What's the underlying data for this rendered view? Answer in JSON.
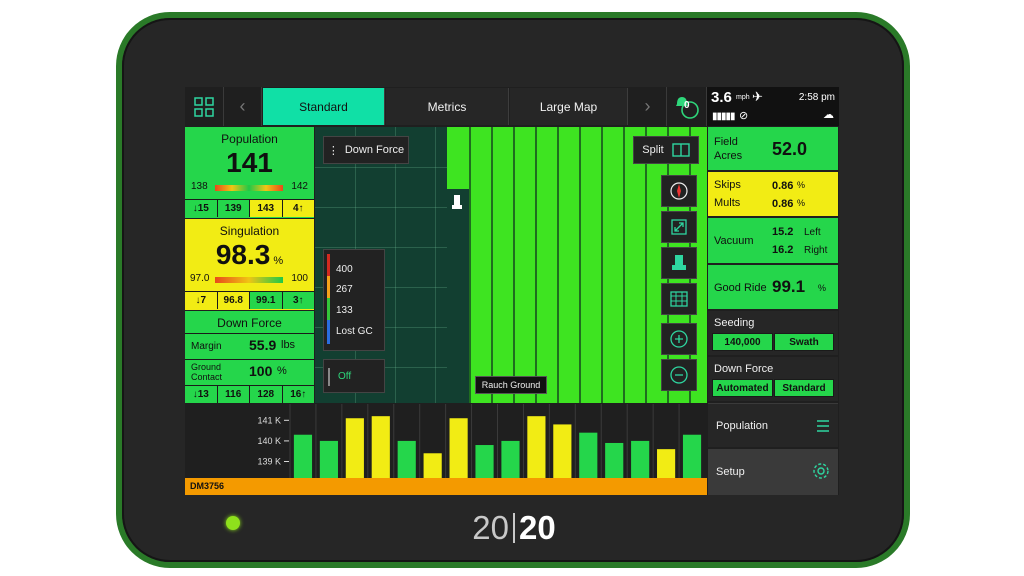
{
  "nav": {
    "tabs": [
      "Standard",
      "Metrics",
      "Large Map"
    ],
    "alert_count": "0"
  },
  "status": {
    "speed": "3.6",
    "speed_unit": "mph",
    "time": "2:58 pm"
  },
  "population": {
    "title": "Population",
    "value": "141",
    "min": "138",
    "max": "142",
    "cells": [
      "↓15",
      "139",
      "143",
      "4↑"
    ]
  },
  "singulation": {
    "title": "Singulation",
    "value": "98.3",
    "unit": "%",
    "min": "97.0",
    "max": "100",
    "cells": [
      "↓7",
      "96.8",
      "99.1",
      "3↑"
    ]
  },
  "down_force": {
    "title": "Down Force",
    "margin_label": "Margin",
    "margin_value": "55.9",
    "margin_unit": "lbs",
    "gc_label_1": "Ground",
    "gc_label_2": "Contact",
    "gc_value": "100",
    "gc_unit": "%",
    "cells": [
      "↓13",
      "116",
      "128",
      "16↑"
    ]
  },
  "map": {
    "layer_button": "Down Force",
    "split_button": "Split",
    "legend": [
      "400",
      "267",
      "133",
      "Lost GC"
    ],
    "legend_colors": [
      "#d22a1f",
      "#f5a31a",
      "#33c83a",
      "#2a6ee0"
    ],
    "toggle_label": "Off",
    "tooltip": "Rauch Ground"
  },
  "field": {
    "label_1": "Field",
    "label_2": "Acres",
    "value": "52.0"
  },
  "skips_mults": {
    "skips_label": "Skips",
    "skips_value": "0.86",
    "skips_unit": "%",
    "mults_label": "Mults",
    "mults_value": "0.86",
    "mults_unit": "%"
  },
  "vacuum": {
    "label": "Vacuum",
    "left_value": "15.2",
    "left_label": "Left",
    "right_value": "16.2",
    "right_label": "Right"
  },
  "good_ride": {
    "label": "Good Ride",
    "value": "99.1",
    "unit": "%"
  },
  "seeding": {
    "label": "Seeding",
    "rate": "140,000",
    "mode": "Swath"
  },
  "down_force_ctrl": {
    "label": "Down Force",
    "mode": "Automated",
    "setting": "Standard"
  },
  "menu": {
    "population": "Population",
    "setup": "Setup"
  },
  "chart_data": {
    "type": "bar",
    "title": "",
    "xlabel": "",
    "ylabel": "",
    "tick_labels": [
      "141 K",
      "140 K",
      "139 K"
    ],
    "ylim": [
      138.2,
      141.5
    ],
    "values": [
      140.3,
      140.0,
      141.1,
      141.2,
      140.0,
      139.4,
      141.1,
      139.8,
      140.0,
      141.2,
      140.8,
      140.4,
      139.9,
      140.0,
      139.6,
      140.3
    ],
    "bar_colors": [
      "#25d64b",
      "#25d64b",
      "#f2ec14",
      "#f2ec14",
      "#25d64b",
      "#f2ec14",
      "#f2ec14",
      "#25d64b",
      "#25d64b",
      "#f2ec14",
      "#f2ec14",
      "#25d64b",
      "#25d64b",
      "#25d64b",
      "#f2ec14",
      "#25d64b"
    ],
    "footer_label": "DM3756"
  }
}
